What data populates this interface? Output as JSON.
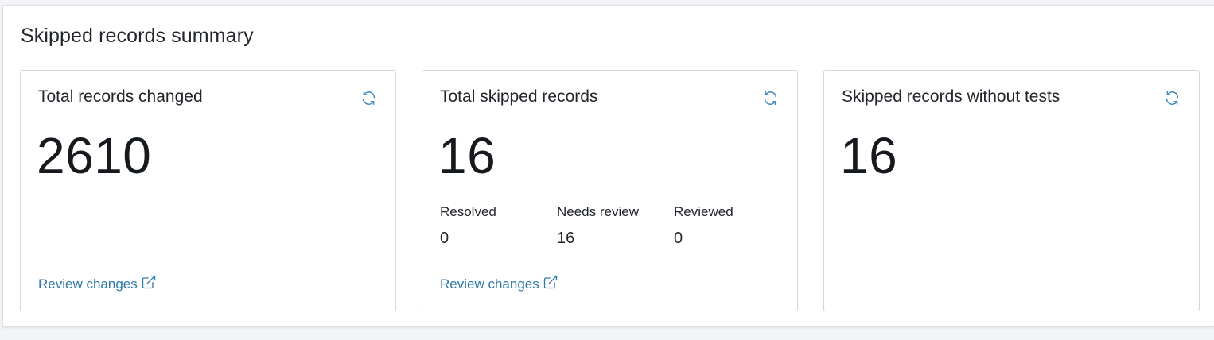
{
  "summary": {
    "title": "Skipped records summary"
  },
  "cards": [
    {
      "title": "Total records changed",
      "value": "2610",
      "link_label": "Review changes"
    },
    {
      "title": "Total skipped records",
      "value": "16",
      "stats": [
        {
          "label": "Resolved",
          "value": "0"
        },
        {
          "label": "Needs review",
          "value": "16"
        },
        {
          "label": "Reviewed",
          "value": "0"
        }
      ],
      "link_label": "Review changes"
    },
    {
      "title": "Skipped records without tests",
      "value": "16"
    }
  ],
  "icons": {
    "refresh": "refresh-icon",
    "external_link": "external-link-icon"
  },
  "colors": {
    "accent": "#2f7aa7",
    "refresh_icon": "#3a86b4",
    "card_border": "#d3d7dc"
  }
}
